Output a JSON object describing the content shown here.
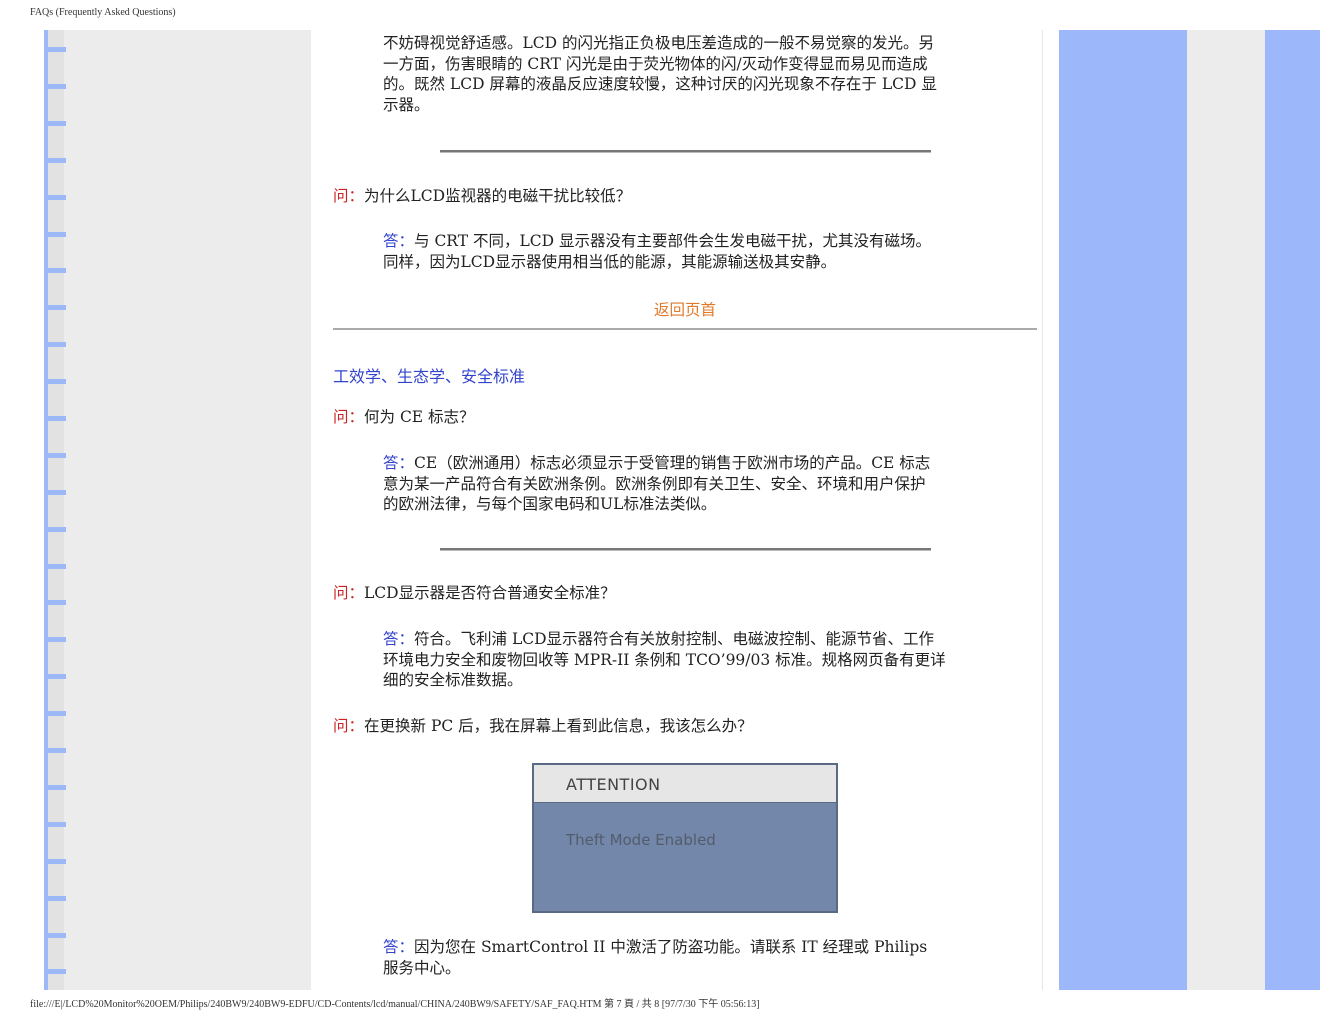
{
  "header": {
    "title": "FAQs (Frequently Asked Questions)"
  },
  "footer": {
    "path": "file:///E|/LCD%20Monitor%20OEM/Philips/240BW9/240BW9-EDFU/CD-Contents/lcd/manual/CHINA/240BW9/SAFETY/SAF_FAQ.HTM 第 7 頁 / 共 8 [97/7/30 下午 05:56:13]"
  },
  "content": {
    "intro": {
      "lines": [
        "不妨碍视觉舒适感。LCD 的闪光指正负极电压差造成的一般不易觉察的发光。另",
        "一方面，伤害眼睛的 CRT 闪光是由于荧光物体的闪/灭动作变得显而易见而造成",
        "的。既然 LCD 屏幕的液晶反应速度较慢，这种讨厌的闪光现象不存在于 LCD 显",
        "示器。"
      ]
    },
    "q1": {
      "label": "问：",
      "text": "为什么LCD监视器的电磁干扰比较低？",
      "answer_label": "答：",
      "answer_line1": "与 CRT 不同，LCD 显示器没有主要部件会生发电磁干扰，尤其没有磁场。",
      "answer_line2": "同样，因为LCD显示器使用相当低的能源，其能源输送极其安静。"
    },
    "back_to_top": "返回页首",
    "section_title": "工效学、生态学、安全标准",
    "q2": {
      "label": "问：",
      "text": "何为 CE 标志？",
      "answer_label": "答：",
      "answer_line1": "CE（欧洲通用）标志必须显示于受管理的销售于欧洲市场的产品。CE 标志",
      "answer_line2": "意为某一产品符合有关欧洲条例。欧洲条例即有关卫生、安全、环境和用户保护",
      "answer_line3": "的欧洲法律，与每个国家电码和UL标准法类似。"
    },
    "q3": {
      "label": "问：",
      "text": "LCD显示器是否符合普通安全标准？",
      "answer_label": "答：",
      "answer_line1": "符合。飞利浦 LCD显示器符合有关放射控制、电磁波控制、能源节省、工作",
      "answer_line2": "环境电力安全和废物回收等 MPR-II 条例和 TCO’99/03 标准。规格网页备有更详",
      "answer_line3": "细的安全标准数据。"
    },
    "q4": {
      "label": "问：",
      "text": "在更换新 PC 后，我在屏幕上看到此信息，我该怎么办？",
      "answer_label": "答：",
      "answer_line1": "因为您在 SmartControl II 中激活了防盗功能。请联系 IT 经理或 Philips",
      "answer_line2": "服务中心。"
    },
    "attention_box": {
      "title": "ATTENTION",
      "message": "Theft Mode Enabled"
    }
  },
  "colors": {
    "question_label": "#cc2222",
    "answer_label": "#3344cc",
    "link": "#e07a2a",
    "side_blue": "#9cb8fb"
  }
}
